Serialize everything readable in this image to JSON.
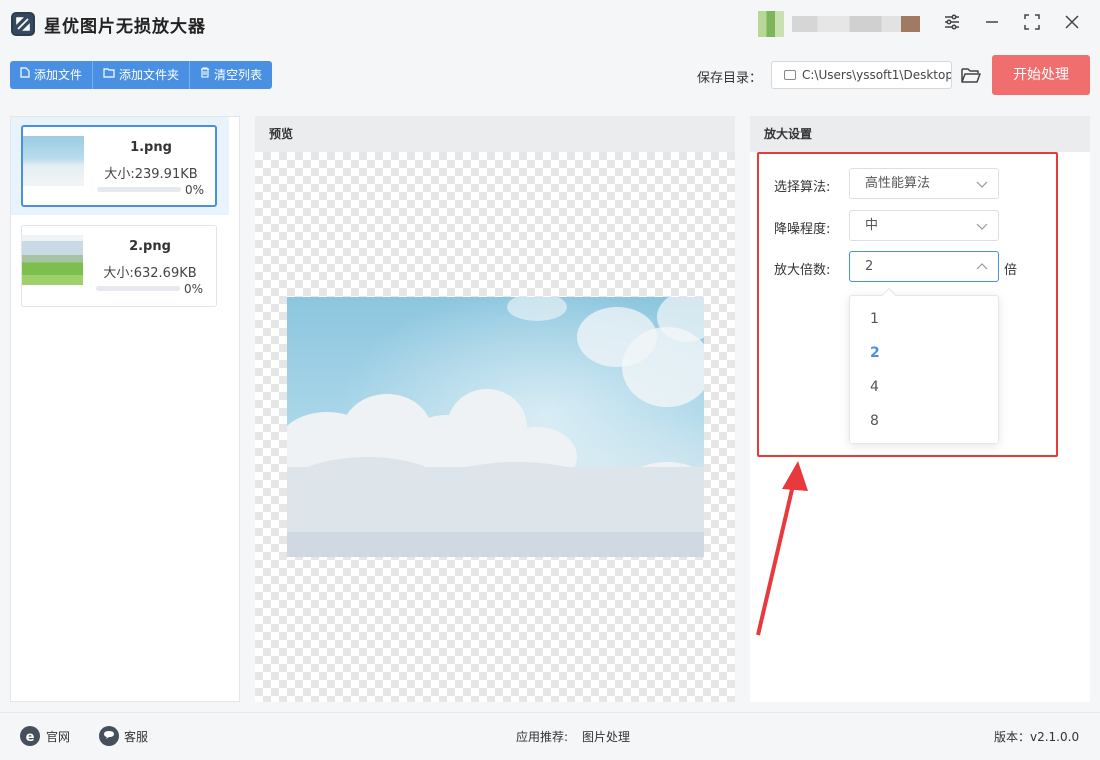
{
  "window": {
    "title": "星优图片无损放大器"
  },
  "toolbar": {
    "add_file": "添加文件",
    "add_folder": "添加文件夹",
    "clear_list": "清空列表",
    "save_label": "保存目录：",
    "save_path": "C:\\Users\\yssoft1\\Desktop",
    "start_button": "开始处理"
  },
  "file_list": {
    "items": [
      {
        "name": "1.png",
        "size": "大小:239.91KB",
        "progress": "0%",
        "progress_value": 0
      },
      {
        "name": "2.png",
        "size": "大小:632.69KB",
        "progress": "0%",
        "progress_value": 0
      }
    ]
  },
  "preview": {
    "header": "预览"
  },
  "settings": {
    "header": "放大设置",
    "algorithm_label": "选择算法:",
    "algorithm_value": "高性能算法",
    "denoise_label": "降噪程度:",
    "denoise_value": "中",
    "scale_label": "放大倍数:",
    "scale_value": "2",
    "scale_unit": "倍",
    "scale_options": [
      "1",
      "2",
      "4",
      "8"
    ],
    "scale_selected_index": 1
  },
  "footer": {
    "website": "官网",
    "support": "客服",
    "recommend_label": "应用推荐:",
    "recommend_value": "图片处理",
    "version": "版本：v2.1.0.0"
  },
  "colors": {
    "primary": "#4a90e2",
    "start_button": "#f06e6e",
    "highlight_frame": "#e8393c"
  }
}
